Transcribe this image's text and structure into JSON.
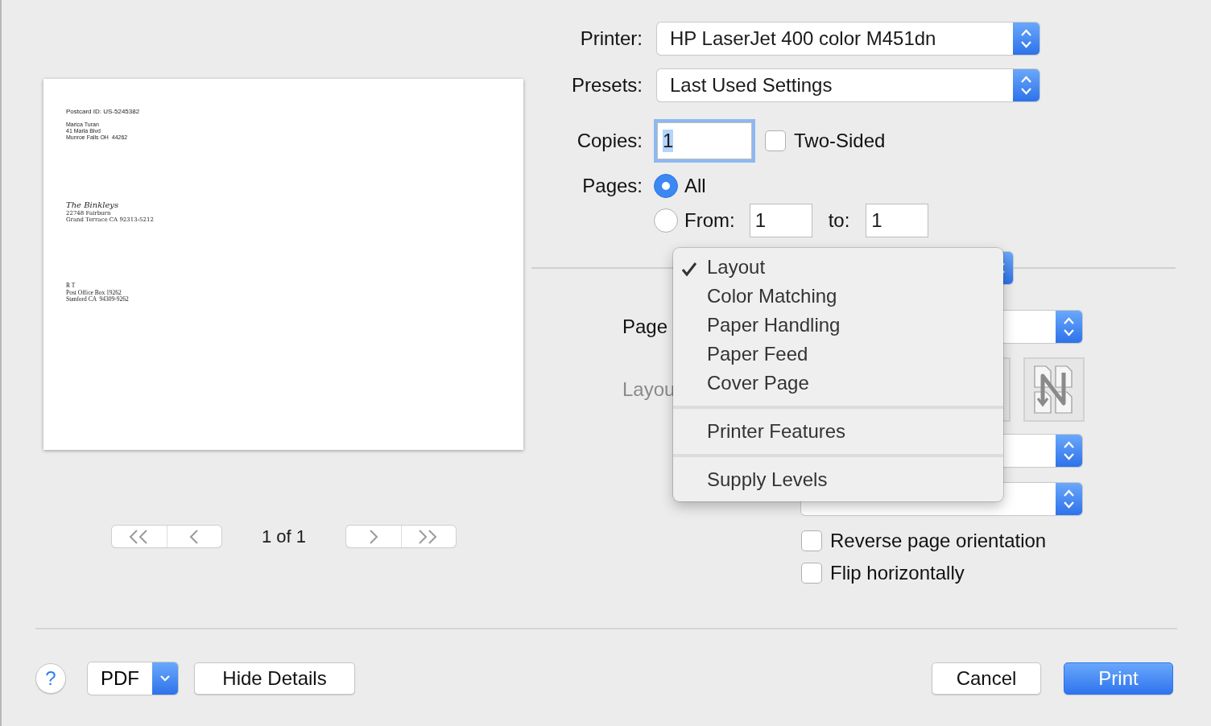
{
  "preview": {
    "blocks": [
      {
        "kind": "sans",
        "lines": [
          "Postcard ID: US-5245382"
        ]
      },
      {
        "kind": "sans",
        "lines": [
          "Marica Turan",
          "41 Marla Blvd",
          "Munroe Falls OH  44262"
        ]
      },
      {
        "kind": "script",
        "lines": [
          "The Binkleys",
          "22748 Fairburn",
          "Grand Terrace CA 92313-5212"
        ]
      },
      {
        "kind": "serif",
        "lines": [
          "R T",
          "Post Office Box 19262",
          "Stanford CA  94309-9262"
        ]
      }
    ],
    "page_indicator": "1 of 1"
  },
  "printer": {
    "label": "Printer:",
    "value": "HP LaserJet 400 color M451dn"
  },
  "presets": {
    "label": "Presets:",
    "value": "Last Used Settings"
  },
  "copies": {
    "label": "Copies:",
    "value": "1",
    "focused": true,
    "two_sided": {
      "label": "Two-Sided",
      "checked": false
    }
  },
  "pages": {
    "label": "Pages:",
    "all": {
      "label": "All",
      "selected": true
    },
    "range": {
      "label": "From:",
      "selected": false,
      "from": "1",
      "to_label": "to:",
      "to": "1"
    }
  },
  "section_menu": {
    "groups": [
      [
        {
          "label": "Layout",
          "selected": true
        },
        {
          "label": "Color Matching",
          "selected": false
        },
        {
          "label": "Paper Handling",
          "selected": false
        },
        {
          "label": "Paper Feed",
          "selected": false
        },
        {
          "label": "Cover Page",
          "selected": false
        }
      ],
      [
        {
          "label": "Printer Features",
          "selected": false
        }
      ],
      [
        {
          "label": "Supply Levels",
          "selected": false
        }
      ]
    ]
  },
  "layout_options": [
    {
      "kind": "select",
      "label": "Page"
    },
    {
      "kind": "direction",
      "label": "Layou",
      "disabled": true
    },
    {
      "kind": "select"
    },
    {
      "kind": "select"
    },
    {
      "kind": "checkbox",
      "label": "Reverse page orientation",
      "checked": false
    },
    {
      "kind": "checkbox",
      "label": "Flip horizontally",
      "checked": false
    }
  ],
  "footer": {
    "help": "?",
    "pdf": "PDF",
    "hide_details": "Hide Details",
    "cancel": "Cancel",
    "print": "Print"
  }
}
